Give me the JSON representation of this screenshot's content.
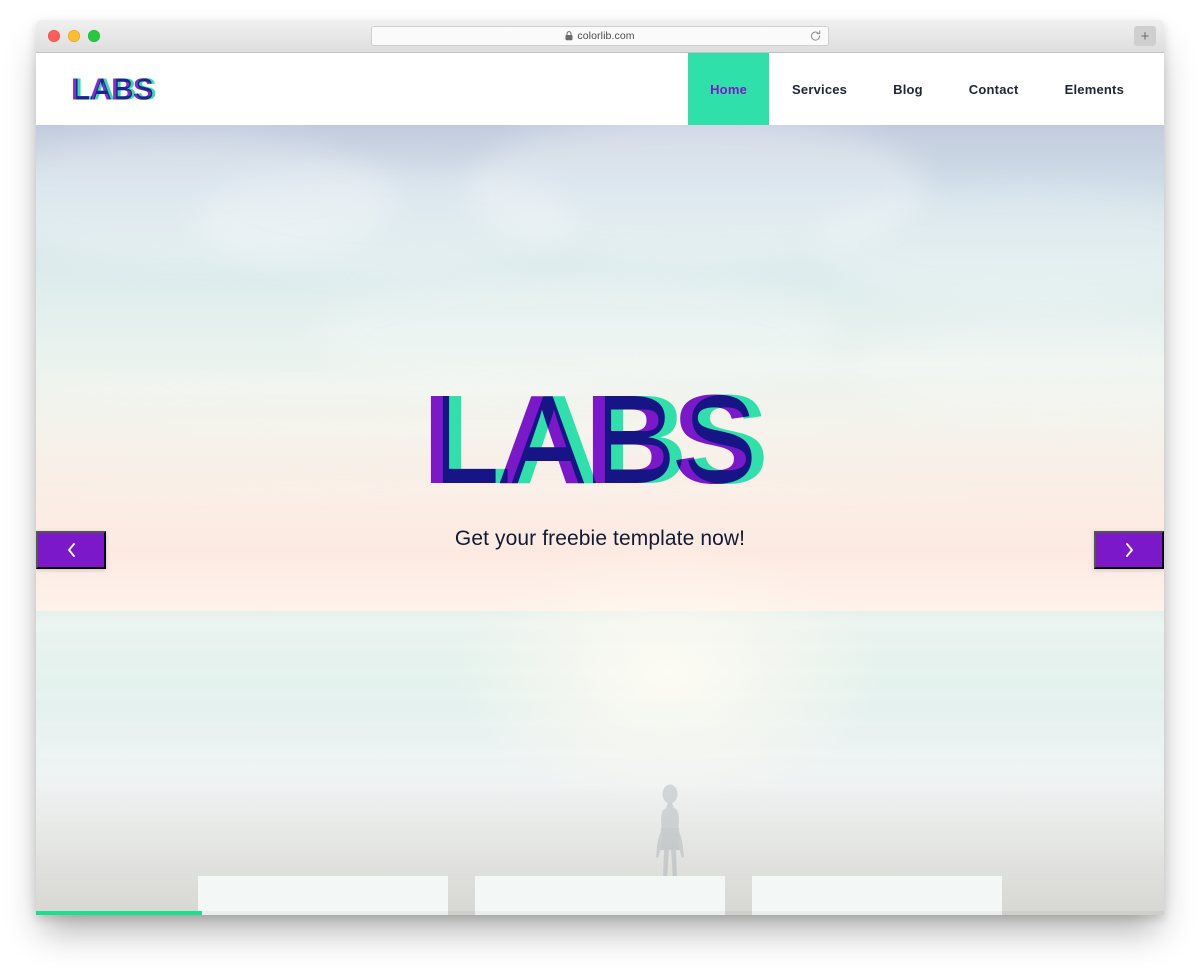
{
  "browser": {
    "url": "colorlib.com",
    "lock_icon": "lock-icon",
    "reload_icon": "reload-icon",
    "newtab_label": "+",
    "traffic_lights": [
      "close-red",
      "minimize-yellow",
      "zoom-green"
    ]
  },
  "site": {
    "brand": "LABS",
    "nav": [
      {
        "label": "Home",
        "active": true
      },
      {
        "label": "Services",
        "active": false
      },
      {
        "label": "Blog",
        "active": false
      },
      {
        "label": "Contact",
        "active": false
      },
      {
        "label": "Elements",
        "active": false
      }
    ]
  },
  "hero": {
    "title": "LABS",
    "subtitle": "Get your freebie template now!",
    "prev_icon": "chevron-left-icon",
    "next_icon": "chevron-right-icon",
    "background_alt": "beach-ocean-sunset-photo",
    "figure_alt": "person-standing-in-water-silhouette"
  },
  "cards": [
    {
      "label": ""
    },
    {
      "label": ""
    },
    {
      "label": ""
    }
  ],
  "colors": {
    "accent_teal": "#2fe0aa",
    "accent_purple": "#7b18c9",
    "nav_text": "#222736",
    "hero_sub_text": "#121b33",
    "scrollbar_thumb": "#18e08e",
    "card_bg": "#f3f8f6"
  }
}
